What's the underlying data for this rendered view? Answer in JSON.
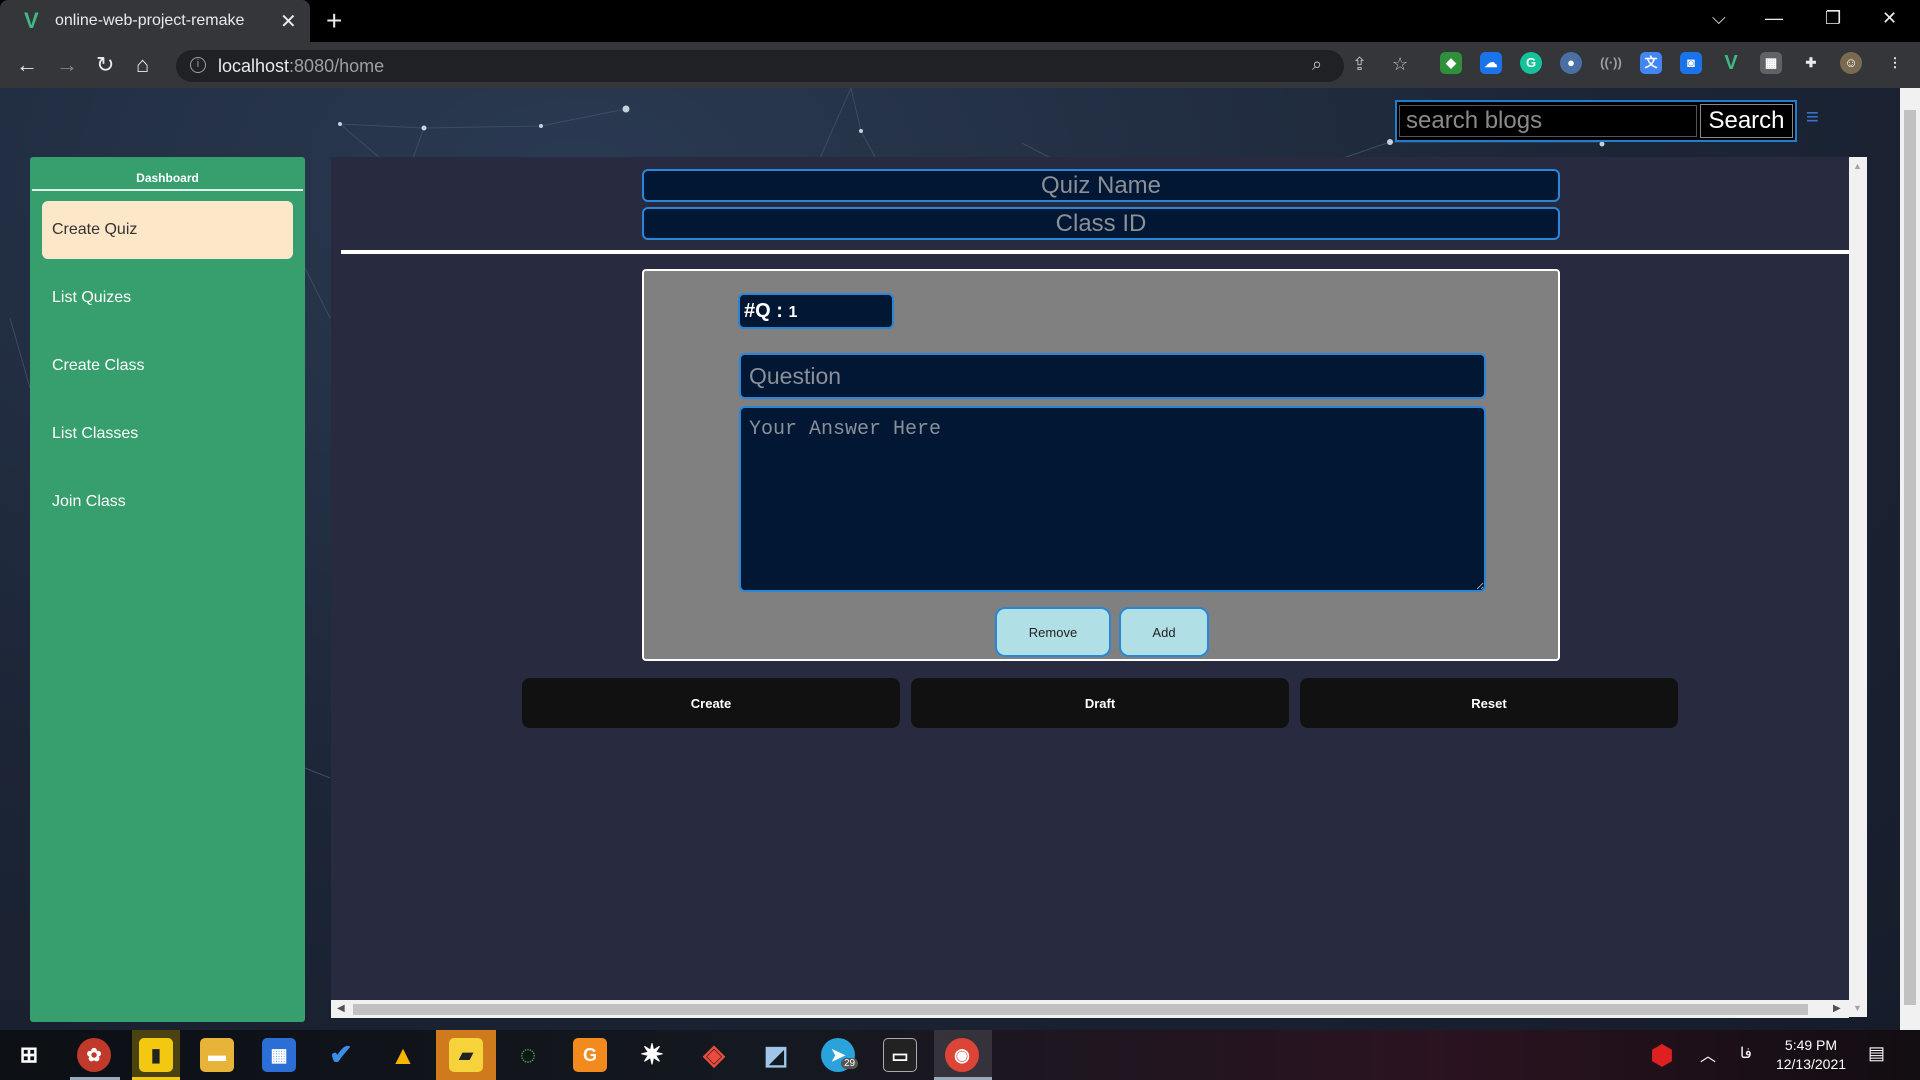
{
  "browser": {
    "tab_title": "online-web-project-remake",
    "tab_favicon": "V",
    "new_tab": "+",
    "close_tab": "✕",
    "url_host": "localhost",
    "url_rest": ":8080/home"
  },
  "header": {
    "search_placeholder": "search blogs",
    "search_button": "Search",
    "menu_icon": "≡"
  },
  "sidebar": {
    "title": "Dashboard",
    "items": [
      {
        "label": "Create Quiz",
        "active": true
      },
      {
        "label": "List Quizes"
      },
      {
        "label": "Create Class"
      },
      {
        "label": "List Classes"
      },
      {
        "label": "Join Class"
      }
    ]
  },
  "quiz": {
    "name_placeholder": "Quiz Name",
    "class_id_placeholder": "Class ID",
    "question_number_prefix": "#Q :",
    "question_number": "1",
    "question_placeholder": "Question",
    "answer_placeholder": "Your Answer Here",
    "remove_button": "Remove",
    "add_button": "Add"
  },
  "actions": {
    "create": "Create",
    "draft": "Draft",
    "reset": "Reset"
  },
  "taskbar": {
    "time": "5:49 PM",
    "date": "12/13/2021",
    "language": "فا",
    "telegram_badge": "29"
  },
  "colors": {
    "sidebar_bg": "#379e6e",
    "active_item_bg": "#fde7c9",
    "panel_bg": "#282a3f",
    "field_bg": "#011733",
    "field_border": "#2a86d8",
    "card_bg": "#808080",
    "card_button_bg": "#b0e0e6"
  }
}
